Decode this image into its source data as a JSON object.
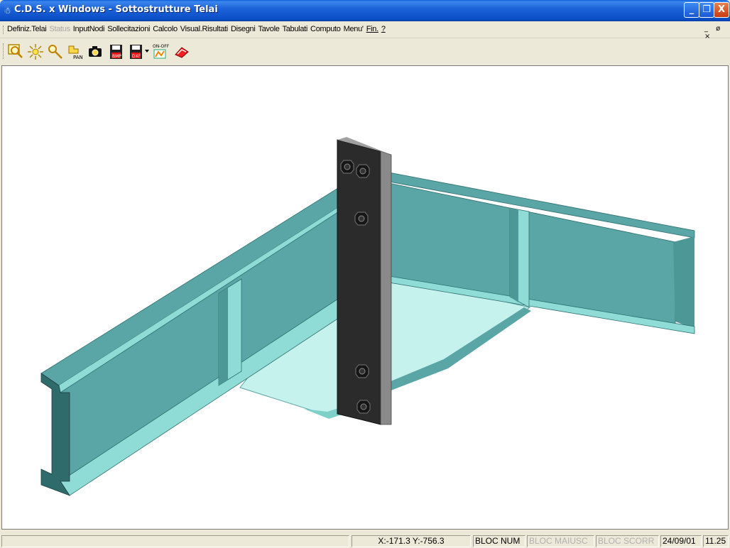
{
  "window": {
    "title": "C.D.S. x Windows - Sottostrutture Telai",
    "minimize": "_",
    "maximize": "❐",
    "close": "X"
  },
  "menu": {
    "items": [
      {
        "label": "Definiz.Telai",
        "enabled": true
      },
      {
        "label": "Status",
        "enabled": false
      },
      {
        "label": "InputNodi",
        "enabled": true
      },
      {
        "label": "Sollecitazioni",
        "enabled": true
      },
      {
        "label": "Calcolo",
        "enabled": true
      },
      {
        "label": "Visual.Risultati",
        "enabled": true
      },
      {
        "label": "Disegni",
        "enabled": true
      },
      {
        "label": "Tavole",
        "enabled": true
      },
      {
        "label": "Tabulati",
        "enabled": true
      },
      {
        "label": "Computo",
        "enabled": true
      },
      {
        "label": "Menu'",
        "enabled": true
      },
      {
        "label": "Fin.",
        "enabled": true
      },
      {
        "label": "?",
        "enabled": true
      }
    ],
    "mdi_controls": "_ ø ×"
  },
  "toolbar": {
    "tools": [
      {
        "icon": "zoom-window-icon"
      },
      {
        "icon": "light-icon"
      },
      {
        "icon": "zoom-icon"
      },
      {
        "icon": "pan-icon",
        "label": "PAN"
      },
      {
        "icon": "camera-icon"
      },
      {
        "icon": "save-bmp-icon",
        "label": "BMP"
      },
      {
        "icon": "save-dxf-icon",
        "label": "DXF"
      },
      {
        "icon": "toggle-layers-icon",
        "label": "ON-OFF"
      },
      {
        "icon": "render-icon"
      }
    ]
  },
  "status": {
    "message": "",
    "coords": "X:-171.3  Y:-756.3",
    "num": "BLOC NUM",
    "caps": "BLOC MAIUSC",
    "scroll": "BLOC SCORR",
    "date": "24/09/01",
    "time": "11.25"
  },
  "colors": {
    "steel": "#5aa5a5",
    "steel_light": "#8fdcd6",
    "steel_dark": "#3e7f7f",
    "plate": "#2a2a2a",
    "plate_edge": "#7d7d7d",
    "title_blue": "#0b4fc8"
  }
}
